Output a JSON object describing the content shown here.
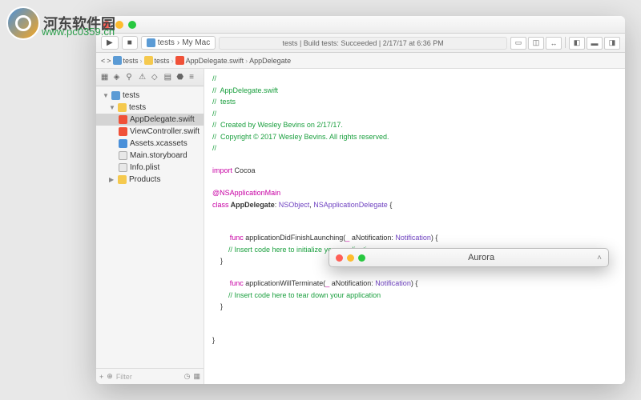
{
  "watermark": {
    "text": "河东软件园",
    "url": "www.pc0359.cn"
  },
  "toolbar": {
    "run_icon": "▶",
    "stop_icon": "■",
    "scheme": "tests",
    "device": "My Mac",
    "status_scheme": "tests",
    "status_text": "Build tests: Succeeded",
    "status_time": "2/17/17 at 6:36 PM"
  },
  "breadcrumb": {
    "nav_left": "<",
    "nav_right": ">",
    "items": [
      "tests",
      "tests",
      "AppDelegate.swift",
      "AppDelegate"
    ]
  },
  "sidebar": {
    "project": "tests",
    "group": "tests",
    "files": [
      "AppDelegate.swift",
      "ViewController.swift",
      "Assets.xcassets",
      "Main.storyboard",
      "Info.plist"
    ],
    "products": "Products",
    "filter_placeholder": "Filter",
    "add": "+"
  },
  "code": {
    "l1": "//",
    "l2": "//  AppDelegate.swift",
    "l3": "//  tests",
    "l4": "//",
    "l5": "//  Created by Wesley Bevins on 2/17/17.",
    "l6": "//  Copyright © 2017 Wesley Bevins. All rights reserved.",
    "l7": "//",
    "l8": "",
    "kw_import": "import",
    "mod_cocoa": " Cocoa",
    "attr_main": "@NSApplicationMain",
    "kw_class": "class",
    "cls_name": " AppDelegate",
    "cls_sep": ": ",
    "cls_super": "NSObject",
    "cls_comma": ", ",
    "cls_proto": "NSApplicationDelegate",
    "cls_open": " {",
    "kw_func1": "func",
    "fn1_name": " applicationDidFinishLaunching",
    "fn1_sig1": "(",
    "fn1_under": "_",
    "fn1_param": " aNotification: ",
    "fn1_type": "Notification",
    "fn1_sig2": ") {",
    "fn1_body": "        // Insert code here to initialize your application",
    "fn1_close": "    }",
    "kw_func2": "func",
    "fn2_name": " applicationWillTerminate",
    "fn2_sig1": "(",
    "fn2_under": "_",
    "fn2_param": " aNotification: ",
    "fn2_type": "Notification",
    "fn2_sig2": ") {",
    "fn2_body": "        // Insert code here to tear down your application",
    "fn2_close": "    }",
    "cls_close": "}"
  },
  "popup": {
    "title": "Aurora"
  }
}
